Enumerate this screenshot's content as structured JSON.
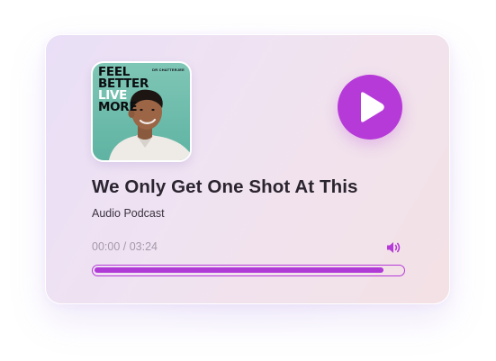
{
  "player": {
    "cover": {
      "title_line1": "FEEL",
      "title_line2": "BETTER",
      "title_line3": "LIVE",
      "title_line4": "MORE",
      "author": "DR CHATTERJEE"
    },
    "title": "We Only Get One Shot At This",
    "subtitle": "Audio Podcast",
    "time_current": "00:00",
    "time_separator": " / ",
    "time_total": "03:24",
    "progress_fraction": 0.94,
    "play_icon": "play-icon",
    "volume_icon": "volume-icon"
  },
  "colors": {
    "accent": "#b63ad8",
    "title_text": "#2b2530",
    "muted_text": "#a49aab",
    "cover_bg": "#6fbcac"
  }
}
